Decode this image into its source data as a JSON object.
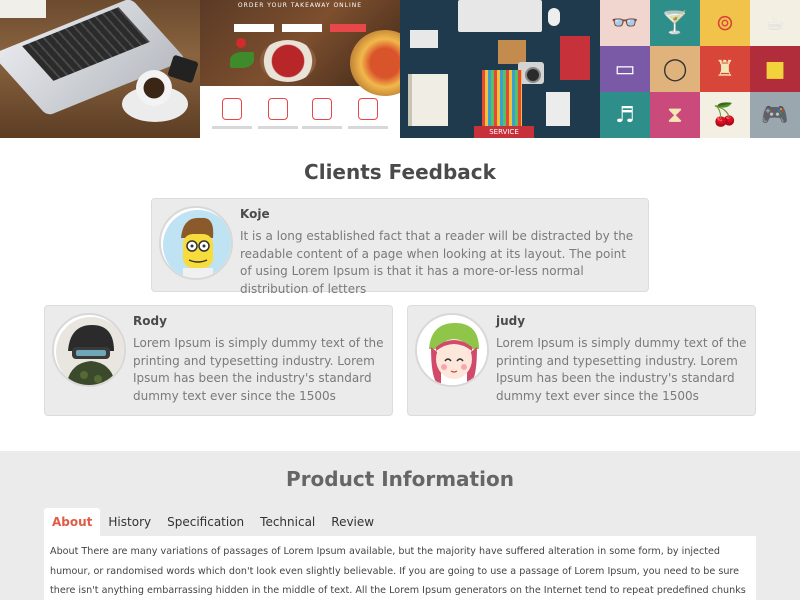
{
  "banner": {
    "takeaway_title": "ORDER YOUR TAKEAWAY ONLINE",
    "service_tag": "SERVICE"
  },
  "feedback": {
    "title": "Clients Feedback",
    "items": [
      {
        "name": "Koje",
        "text": "It is a long established fact that a reader will be distracted by the readable content of a page when looking at its layout. The point of using Lorem Ipsum is that it has a more-or-less normal distribution of letters"
      },
      {
        "name": "Rody",
        "text": "Lorem Ipsum is simply dummy text of the printing and typesetting industry. Lorem Ipsum has been the industry's standard dummy text ever since the 1500s"
      },
      {
        "name": "judy",
        "text": "Lorem Ipsum is simply dummy text of the printing and typesetting industry. Lorem Ipsum has been the industry's standard dummy text ever since the 1500s"
      }
    ]
  },
  "product": {
    "title": "Product Information",
    "tabs": [
      "About",
      "History",
      "Specification",
      "Technical",
      "Review"
    ],
    "active_tab": "About",
    "about_text": "About There are many variations of passages of Lorem Ipsum available, but the majority have suffered alteration in some form, by injected humour, or randomised words which don't look even slightly believable. If you are going to use a passage of Lorem Ipsum, you need to be sure there isn't anything embarrassing hidden in the middle of text. All the Lorem Ipsum generators on the Internet tend to repeat predefined chunks as necessary, making this the"
  },
  "colors": {
    "accent": "#e25b45",
    "section_bg": "#ebebeb"
  }
}
